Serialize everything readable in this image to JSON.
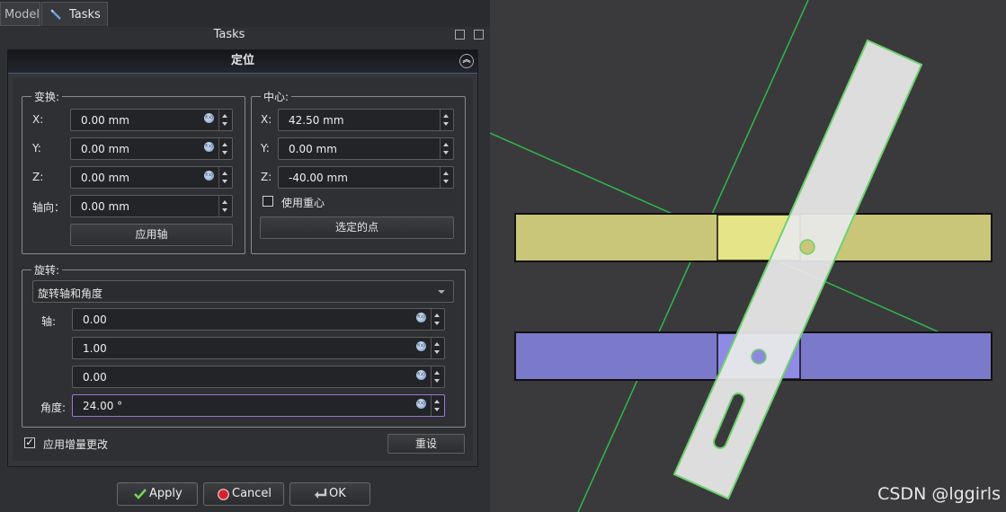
{
  "tabs": [
    {
      "label": "Model",
      "active": false
    },
    {
      "label": "Tasks",
      "active": true
    }
  ],
  "panel_title": "Tasks",
  "dialog": {
    "title": "定位",
    "translation": {
      "legend": "变换:",
      "rows": [
        {
          "label": "X:",
          "value": "0.00 mm"
        },
        {
          "label": "Y:",
          "value": "0.00 mm"
        },
        {
          "label": "Z:",
          "value": "0.00 mm"
        },
        {
          "label": "轴向：",
          "value": "0.00 mm"
        }
      ],
      "apply_axis_label": "应用轴"
    },
    "center": {
      "legend": "中心:",
      "rows": [
        {
          "label": "X:",
          "value": "42.50 mm"
        },
        {
          "label": "Y:",
          "value": "0.00 mm"
        },
        {
          "label": "Z:",
          "value": "-40.00 mm"
        }
      ],
      "use_center_of_mass_label": "使用重心",
      "use_center_of_mass_checked": false,
      "selected_points_label": "选定的点"
    },
    "rotation": {
      "legend": "旋转:",
      "mode": "旋转轴和角度",
      "axis_label": "轴:",
      "axis_values": [
        "0.00",
        "1.00",
        "0.00"
      ],
      "angle_label": "角度:",
      "angle_value": "24.00 °"
    },
    "incremental_label": "应用增量更改",
    "incremental_checked": true,
    "reset_label": "重设"
  },
  "buttons": {
    "apply": "Apply",
    "cancel": "Cancel",
    "ok": "OK"
  },
  "watermark": "CSDN @lggirls",
  "colors": {
    "background": "#3a3a3c",
    "panel": "#2f3033",
    "guide_line": "#2fb84a",
    "selection_outline": "#6ed16e",
    "yellow_bar": "#c9c67a",
    "blue_bar": "#7b79c9",
    "focus_border": "#9a78d0"
  }
}
